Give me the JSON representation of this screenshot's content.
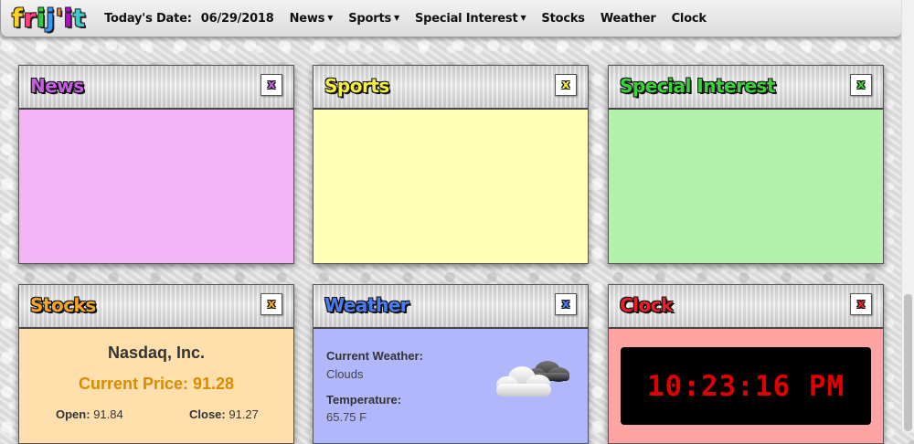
{
  "app": {
    "logo_letters": [
      {
        "char": "f",
        "color": "#ffd21e"
      },
      {
        "char": "r",
        "color": "#ff3d7f"
      },
      {
        "char": "i",
        "color": "#2ecc40"
      },
      {
        "char": "j",
        "color": "#3399ff"
      },
      {
        "char": "'",
        "color": "#ff851b"
      },
      {
        "char": "i",
        "color": "#b10dc9"
      },
      {
        "char": "t",
        "color": "#39cccc"
      }
    ]
  },
  "nav": {
    "date_label": "Today's Date:",
    "date_value": "06/29/2018",
    "news": "News",
    "sports": "Sports",
    "special_interest": "Special Interest",
    "stocks": "Stocks",
    "weather": "Weather",
    "clock": "Clock",
    "caret": "▼"
  },
  "widgets": {
    "news": {
      "title": "News",
      "title_color": "#c55ee0",
      "body_color": "#f3b3f5",
      "close": "x"
    },
    "sports": {
      "title": "Sports",
      "title_color": "#f5f03a",
      "body_color": "#ffffb5",
      "close": "x"
    },
    "special": {
      "title": "Special Interest",
      "title_color": "#39d23a",
      "body_color": "#b1f1a9",
      "close": "x"
    },
    "stocks": {
      "title": "Stocks",
      "title_color": "#f5a623",
      "body_color": "#ffe0ad",
      "close": "x",
      "company": "Nasdaq, Inc.",
      "price_label": "Current Price: 91.28",
      "open_label": "Open:",
      "open_value": "91.84",
      "close_label": "Close:",
      "close_value": "91.27"
    },
    "weather": {
      "title": "Weather",
      "title_color": "#4b7bec",
      "body_color": "#b0b8fb",
      "close": "x",
      "current_label": "Current Weather:",
      "current_value": "Clouds",
      "temp_label": "Temperature:",
      "temp_value": "65.75 F",
      "icon": "cloud-icon"
    },
    "clock": {
      "title": "Clock",
      "title_color": "#e8202a",
      "body_color": "#ffa3a3",
      "close": "x",
      "time": "10:23:16 PM",
      "time_color": "#e00000"
    }
  }
}
